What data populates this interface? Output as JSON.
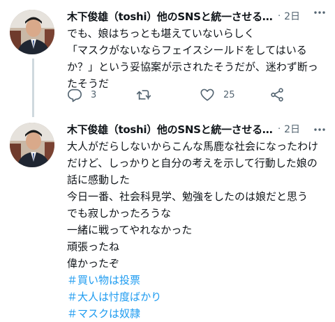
{
  "tweets": [
    {
      "author": "木下俊雄（toshi）他のSNSと統一させるた...",
      "separator": "·",
      "time": "2日",
      "text": "でも、娘はちっとも堪えていないらしく\n「マスクがないならフェイスシールドをしてはいるか？」という妥協案が示されたそうだが、迷わず断ったそうだ",
      "reply_count": "3",
      "like_count": "25"
    },
    {
      "author": "木下俊雄（toshi）他のSNSと統一させるた...",
      "separator": "·",
      "time": "2日",
      "text": "大人がだらしないからこんな馬鹿な社会になったわけだけど、しっかりと自分の考えを示して行動した娘の話に感動した\n今日一番、社会科見学、勉強をしたのは娘だと思う\nでも寂しかったろうな\n一緒に戦ってやれなかった\n頑張ったね\n偉かったぞ",
      "hashtags": [
        "＃買い物は投票",
        "＃大人は忖度ばかり",
        "＃マスクは奴隷"
      ]
    }
  ],
  "colors": {
    "text": "#0f1419",
    "secondary": "#536471",
    "link": "#1d9bf0",
    "thread_line": "#cfd9de"
  },
  "icons": [
    "more-icon",
    "reply-icon",
    "retweet-icon",
    "like-icon",
    "share-icon"
  ]
}
